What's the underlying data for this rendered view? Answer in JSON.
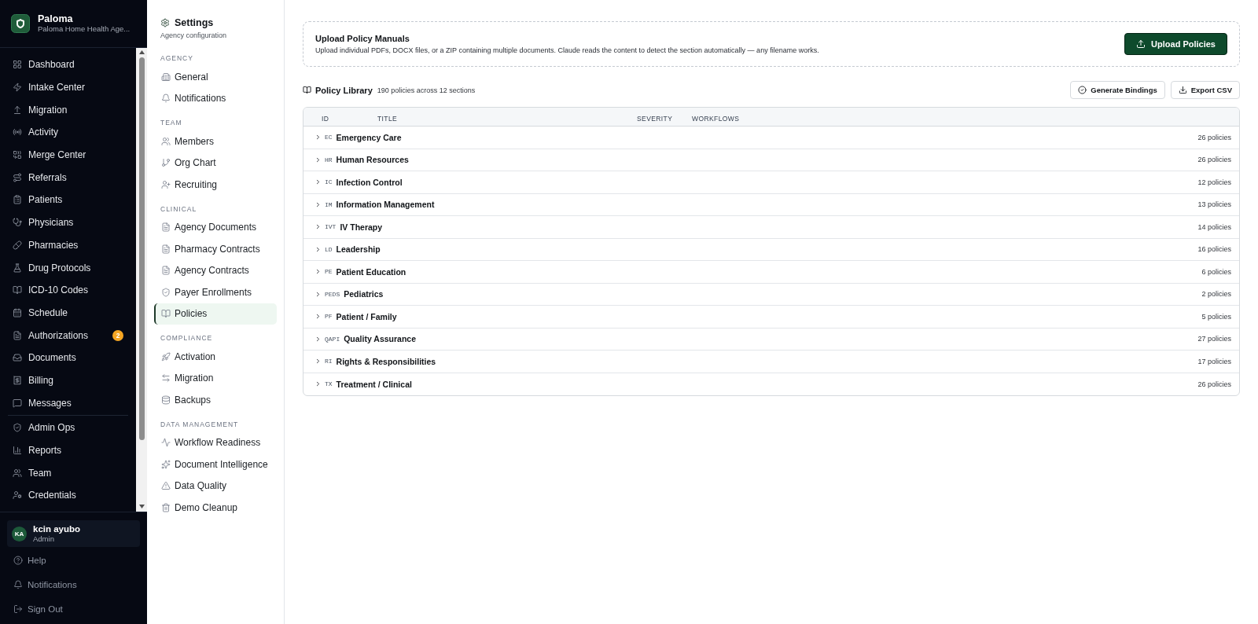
{
  "sidebar": {
    "brand": {
      "name": "Paloma",
      "subtitle": "Paloma Home Health Age..."
    },
    "nav_sections": [
      {
        "items": [
          {
            "label": "Dashboard"
          },
          {
            "label": "Intake Center"
          },
          {
            "label": "Migration"
          },
          {
            "label": "Activity"
          },
          {
            "label": "Merge Center"
          },
          {
            "label": "Referrals"
          },
          {
            "label": "Patients"
          },
          {
            "label": "Physicians"
          },
          {
            "label": "Pharmacies"
          },
          {
            "label": "Drug Protocols"
          },
          {
            "label": "ICD-10 Codes"
          },
          {
            "label": "Schedule"
          },
          {
            "label": "Authorizations",
            "badge": "2"
          },
          {
            "label": "Documents"
          },
          {
            "label": "Billing"
          },
          {
            "label": "Messages"
          }
        ]
      },
      {
        "items": [
          {
            "label": "Admin Ops"
          },
          {
            "label": "Reports"
          },
          {
            "label": "Team"
          },
          {
            "label": "Credentials"
          }
        ]
      }
    ],
    "user": {
      "initials": "KA",
      "name": "kcin ayubo",
      "role": "Admin"
    },
    "footer_links": [
      {
        "label": "Help"
      },
      {
        "label": "Notifications"
      },
      {
        "label": "Sign Out"
      }
    ]
  },
  "settings_panel": {
    "title": "Settings",
    "subtitle": "Agency configuration",
    "sections": [
      {
        "heading": "AGENCY",
        "items": [
          {
            "label": "General",
            "selected": false
          },
          {
            "label": "Notifications",
            "selected": false
          }
        ]
      },
      {
        "heading": "TEAM",
        "items": [
          {
            "label": "Members",
            "selected": false
          },
          {
            "label": "Org Chart",
            "selected": false
          },
          {
            "label": "Recruiting",
            "selected": false
          }
        ]
      },
      {
        "heading": "CLINICAL",
        "items": [
          {
            "label": "Agency Documents",
            "selected": false
          },
          {
            "label": "Pharmacy Contracts",
            "selected": false
          },
          {
            "label": "Agency Contracts",
            "selected": false
          },
          {
            "label": "Payer Enrollments",
            "selected": false
          },
          {
            "label": "Policies",
            "selected": true
          }
        ]
      },
      {
        "heading": "COMPLIANCE",
        "items": [
          {
            "label": "Activation",
            "selected": false
          },
          {
            "label": "Migration",
            "selected": false
          },
          {
            "label": "Backups",
            "selected": false
          }
        ]
      },
      {
        "heading": "DATA MANAGEMENT",
        "items": [
          {
            "label": "Workflow Readiness",
            "selected": false
          },
          {
            "label": "Document Intelligence",
            "selected": false
          },
          {
            "label": "Data Quality",
            "selected": false
          },
          {
            "label": "Demo Cleanup",
            "selected": false
          }
        ]
      }
    ]
  },
  "upload_card": {
    "title": "Upload Policy Manuals",
    "description": "Upload individual PDFs, DOCX files, or a ZIP containing multiple documents. Claude reads the content to detect the section automatically — any filename works.",
    "button": "Upload Policies"
  },
  "policy_library": {
    "title": "Policy Library",
    "summary": "190 policies across 12 sections",
    "buttons": [
      "Generate Bindings",
      "Export CSV"
    ],
    "table": {
      "columns": [
        "ID",
        "TITLE",
        "SEVERITY",
        "WORKFLOWS"
      ],
      "rows": [
        {
          "code": "EC",
          "title": "Emergency Care",
          "count": "26 policies",
          "expanded": false
        },
        {
          "code": "HR",
          "title": "Human Resources",
          "count": "26 policies",
          "expanded": false
        },
        {
          "code": "IC",
          "title": "Infection Control",
          "count": "12 policies",
          "expanded": false
        },
        {
          "code": "IM",
          "title": "Information Management",
          "count": "13 policies",
          "expanded": false
        },
        {
          "code": "IVT",
          "title": "IV Therapy",
          "count": "14 policies",
          "expanded": false
        },
        {
          "code": "LD",
          "title": "Leadership",
          "count": "16 policies",
          "expanded": false
        },
        {
          "code": "PE",
          "title": "Patient Education",
          "count": "6 policies",
          "expanded": false
        },
        {
          "code": "PEDS",
          "title": "Pediatrics",
          "count": "2 policies",
          "expanded": false
        },
        {
          "code": "PF",
          "title": "Patient / Family",
          "count": "5 policies",
          "expanded": false
        },
        {
          "code": "QAPI",
          "title": "Quality Assurance",
          "count": "27 policies",
          "expanded": false
        },
        {
          "code": "RI",
          "title": "Rights & Responsibilities",
          "count": "17 policies",
          "expanded": false
        },
        {
          "code": "TX",
          "title": "Treatment / Clinical",
          "count": "26 policies",
          "expanded": false
        }
      ]
    }
  }
}
